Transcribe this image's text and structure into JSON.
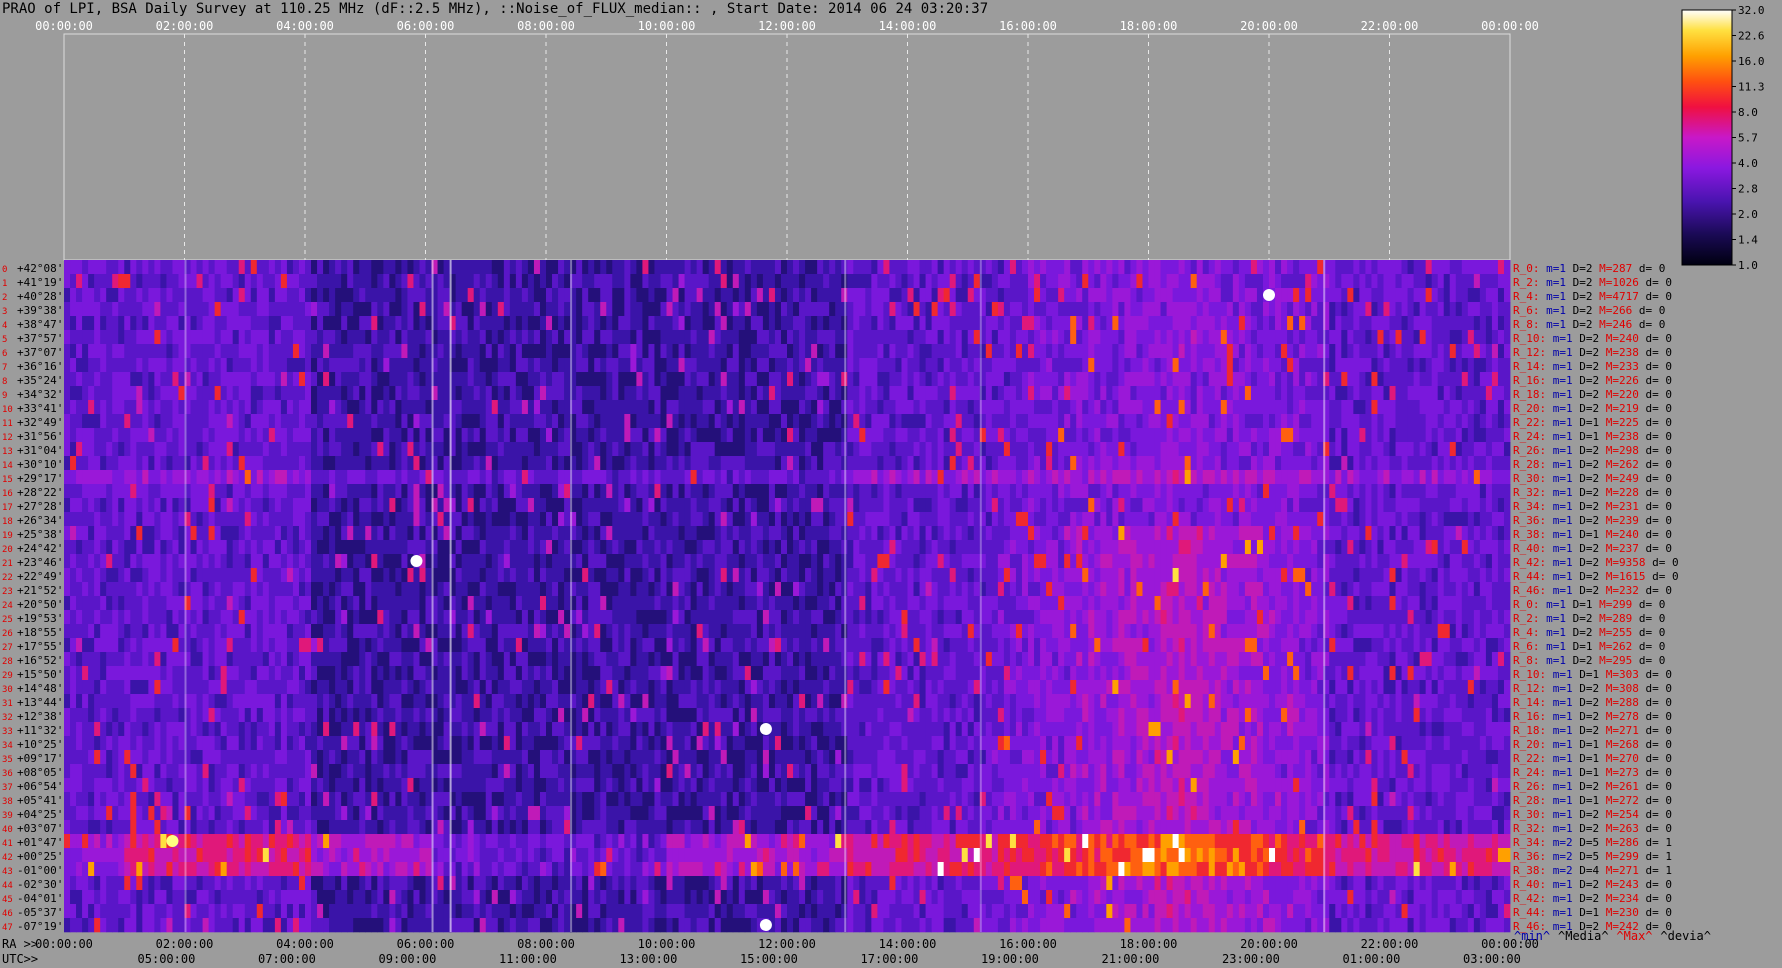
{
  "title": "PRAO of LPI, BSA Daily Survey at 110.25 MHz (dF::2.5 MHz), ::Noise_of_FLUX_median:: , Start Date: 2014 06 24 03:20:37",
  "chart_data": {
    "type": "heatmap",
    "top_axis_ticks": [
      "00:00:00",
      "02:00:00",
      "04:00:00",
      "06:00:00",
      "08:00:00",
      "10:00:00",
      "12:00:00",
      "14:00:00",
      "16:00:00",
      "18:00:00",
      "20:00:00",
      "22:00:00",
      "00:00:00"
    ],
    "ra_label": "RA >>",
    "ra_ticks": [
      "00:00:00",
      "02:00:00",
      "04:00:00",
      "06:00:00",
      "08:00:00",
      "10:00:00",
      "12:00:00",
      "14:00:00",
      "16:00:00",
      "18:00:00",
      "20:00:00",
      "22:00:00",
      "00:00:00"
    ],
    "utc_label": "UTC>>",
    "utc_ticks": [
      "05:00:00",
      "07:00:00",
      "09:00:00",
      "11:00:00",
      "13:00:00",
      "15:00:00",
      "17:00:00",
      "19:00:00",
      "21:00:00",
      "23:00:00",
      "01:00:00",
      "03:00:00"
    ],
    "utc_ticks_ra_hours": [
      1.7,
      3.7,
      5.7,
      7.7,
      9.7,
      11.7,
      13.7,
      15.7,
      17.7,
      19.7,
      21.7,
      23.7
    ],
    "declinations": [
      "+42°08'",
      "+41°19'",
      "+40°28'",
      "+39°38'",
      "+38°47'",
      "+37°57'",
      "+37°07'",
      "+36°16'",
      "+35°24'",
      "+34°32'",
      "+33°41'",
      "+32°49'",
      "+31°56'",
      "+31°04'",
      "+30°10'",
      "+29°17'",
      "+28°22'",
      "+27°28'",
      "+26°34'",
      "+25°38'",
      "+24°42'",
      "+23°46'",
      "+22°49'",
      "+21°52'",
      "+20°50'",
      "+19°53'",
      "+18°55'",
      "+17°55'",
      "+16°52'",
      "+15°50'",
      "+14°48'",
      "+13°44'",
      "+12°38'",
      "+11°32'",
      "+10°25'",
      "+09°17'",
      "+08°05'",
      "+06°54'",
      "+05°41'",
      "+04°25'",
      "+03°07'",
      "+01°47'",
      "+00°25'",
      "-01°00'",
      "-02°30'",
      "-04°01'",
      "-05°37'",
      "-07°19'"
    ],
    "row_index_labels": [
      "0",
      "1",
      "2",
      "3",
      "4",
      "5",
      "6",
      "7",
      "8",
      "9",
      "10",
      "11",
      "12",
      "13",
      "14",
      "15",
      "16",
      "17",
      "18",
      "19",
      "20",
      "21",
      "22",
      "23",
      "24",
      "25",
      "26",
      "27",
      "28",
      "29",
      "30",
      "31",
      "32",
      "33",
      "34",
      "35",
      "36",
      "37",
      "38",
      "39",
      "40",
      "41",
      "42",
      "43",
      "44",
      "45",
      "46",
      "47"
    ],
    "receivers": [
      {
        "r": "R_0:",
        "m": "m=1",
        "d": "D=2",
        "max": "M=287",
        "dev": "d= 0"
      },
      {
        "r": "R_2:",
        "m": "m=1",
        "d": "D=2",
        "max": "M=1026",
        "dev": "d= 0"
      },
      {
        "r": "R_4:",
        "m": "m=1",
        "d": "D=2",
        "max": "M=4717",
        "dev": "d= 0"
      },
      {
        "r": "R_6:",
        "m": "m=1",
        "d": "D=2",
        "max": "M=266",
        "dev": "d= 0"
      },
      {
        "r": "R_8:",
        "m": "m=1",
        "d": "D=2",
        "max": "M=246",
        "dev": "d= 0"
      },
      {
        "r": "R_10:",
        "m": "m=1",
        "d": "D=2",
        "max": "M=240",
        "dev": "d= 0"
      },
      {
        "r": "R_12:",
        "m": "m=1",
        "d": "D=2",
        "max": "M=238",
        "dev": "d= 0"
      },
      {
        "r": "R_14:",
        "m": "m=1",
        "d": "D=2",
        "max": "M=233",
        "dev": "d= 0"
      },
      {
        "r": "R_16:",
        "m": "m=1",
        "d": "D=2",
        "max": "M=226",
        "dev": "d= 0"
      },
      {
        "r": "R_18:",
        "m": "m=1",
        "d": "D=2",
        "max": "M=220",
        "dev": "d= 0"
      },
      {
        "r": "R_20:",
        "m": "m=1",
        "d": "D=2",
        "max": "M=219",
        "dev": "d= 0"
      },
      {
        "r": "R_22:",
        "m": "m=1",
        "d": "D=1",
        "max": "M=225",
        "dev": "d= 0"
      },
      {
        "r": "R_24:",
        "m": "m=1",
        "d": "D=1",
        "max": "M=238",
        "dev": "d= 0"
      },
      {
        "r": "R_26:",
        "m": "m=1",
        "d": "D=2",
        "max": "M=298",
        "dev": "d= 0"
      },
      {
        "r": "R_28:",
        "m": "m=1",
        "d": "D=2",
        "max": "M=262",
        "dev": "d= 0"
      },
      {
        "r": "R_30:",
        "m": "m=1",
        "d": "D=2",
        "max": "M=249",
        "dev": "d= 0"
      },
      {
        "r": "R_32:",
        "m": "m=1",
        "d": "D=2",
        "max": "M=228",
        "dev": "d= 0"
      },
      {
        "r": "R_34:",
        "m": "m=1",
        "d": "D=2",
        "max": "M=231",
        "dev": "d= 0"
      },
      {
        "r": "R_36:",
        "m": "m=1",
        "d": "D=2",
        "max": "M=239",
        "dev": "d= 0"
      },
      {
        "r": "R_38:",
        "m": "m=1",
        "d": "D=1",
        "max": "M=240",
        "dev": "d= 0"
      },
      {
        "r": "R_40:",
        "m": "m=1",
        "d": "D=2",
        "max": "M=237",
        "dev": "d= 0"
      },
      {
        "r": "R_42:",
        "m": "m=1",
        "d": "D=2",
        "max": "M=9358",
        "dev": "d= 0"
      },
      {
        "r": "R_44:",
        "m": "m=1",
        "d": "D=2",
        "max": "M=1615",
        "dev": "d= 0"
      },
      {
        "r": "R_46:",
        "m": "m=1",
        "d": "D=2",
        "max": "M=232",
        "dev": "d= 0"
      },
      {
        "r": "R_0:",
        "m": "m=1",
        "d": "D=1",
        "max": "M=299",
        "dev": "d= 0"
      },
      {
        "r": "R_2:",
        "m": "m=1",
        "d": "D=2",
        "max": "M=289",
        "dev": "d= 0"
      },
      {
        "r": "R_4:",
        "m": "m=1",
        "d": "D=2",
        "max": "M=255",
        "dev": "d= 0"
      },
      {
        "r": "R_6:",
        "m": "m=1",
        "d": "D=1",
        "max": "M=262",
        "dev": "d= 0"
      },
      {
        "r": "R_8:",
        "m": "m=1",
        "d": "D=2",
        "max": "M=295",
        "dev": "d= 0"
      },
      {
        "r": "R_10:",
        "m": "m=1",
        "d": "D=1",
        "max": "M=303",
        "dev": "d= 0"
      },
      {
        "r": "R_12:",
        "m": "m=1",
        "d": "D=2",
        "max": "M=308",
        "dev": "d= 0"
      },
      {
        "r": "R_14:",
        "m": "m=1",
        "d": "D=2",
        "max": "M=288",
        "dev": "d= 0"
      },
      {
        "r": "R_16:",
        "m": "m=1",
        "d": "D=2",
        "max": "M=278",
        "dev": "d= 0"
      },
      {
        "r": "R_18:",
        "m": "m=1",
        "d": "D=2",
        "max": "M=271",
        "dev": "d= 0"
      },
      {
        "r": "R_20:",
        "m": "m=1",
        "d": "D=1",
        "max": "M=268",
        "dev": "d= 0"
      },
      {
        "r": "R_22:",
        "m": "m=1",
        "d": "D=1",
        "max": "M=270",
        "dev": "d= 0"
      },
      {
        "r": "R_24:",
        "m": "m=1",
        "d": "D=1",
        "max": "M=273",
        "dev": "d= 0"
      },
      {
        "r": "R_26:",
        "m": "m=1",
        "d": "D=2",
        "max": "M=261",
        "dev": "d= 0"
      },
      {
        "r": "R_28:",
        "m": "m=1",
        "d": "D=1",
        "max": "M=272",
        "dev": "d= 0"
      },
      {
        "r": "R_30:",
        "m": "m=1",
        "d": "D=2",
        "max": "M=254",
        "dev": "d= 0"
      },
      {
        "r": "R_32:",
        "m": "m=1",
        "d": "D=2",
        "max": "M=263",
        "dev": "d= 0"
      },
      {
        "r": "R_34:",
        "m": "m=2",
        "d": "D=5",
        "max": "M=286",
        "dev": "d= 1"
      },
      {
        "r": "R_36:",
        "m": "m=2",
        "d": "D=5",
        "max": "M=299",
        "dev": "d= 1"
      },
      {
        "r": "R_38:",
        "m": "m=2",
        "d": "D=4",
        "max": "M=271",
        "dev": "d= 1"
      },
      {
        "r": "R_40:",
        "m": "m=1",
        "d": "D=2",
        "max": "M=243",
        "dev": "d= 0"
      },
      {
        "r": "R_42:",
        "m": "m=1",
        "d": "D=2",
        "max": "M=234",
        "dev": "d= 0"
      },
      {
        "r": "R_44:",
        "m": "m=1",
        "d": "D=1",
        "max": "M=230",
        "dev": "d= 0"
      },
      {
        "r": "R_46:",
        "m": "m=1",
        "d": "D=2",
        "max": "M=242",
        "dev": "d= 0"
      }
    ],
    "legend_stats": [
      {
        "label": "^min^",
        "color": "#0000aa"
      },
      {
        "label": "^Media^",
        "color": "#000000"
      },
      {
        "label": "^Max^",
        "color": "#e00000"
      },
      {
        "label": "^devia^",
        "color": "#000000"
      }
    ],
    "colorbar_ticks": [
      "32.0",
      "22.6",
      "16.0",
      "11.3",
      "8.0",
      "5.7",
      "4.0",
      "2.8",
      "2.0",
      "1.4",
      "1.0"
    ],
    "colorbar_range": [
      1.0,
      32.0
    ],
    "colorbar_scale": "log",
    "x_range_hours": [
      0,
      24
    ],
    "colors": {
      "background": "#9c9c9c",
      "label_red": "#e00000",
      "label_blue": "#0000aa"
    }
  }
}
